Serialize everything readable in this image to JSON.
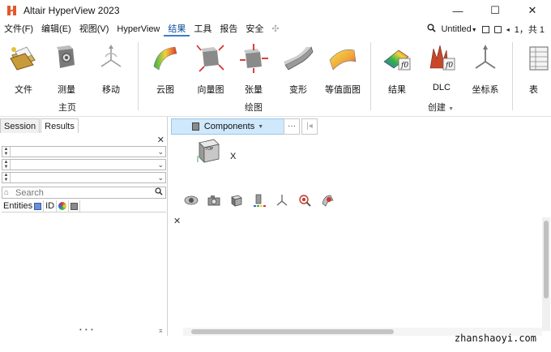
{
  "window": {
    "title": "Altair HyperView 2023",
    "minimize": "—",
    "maximize": "☐",
    "close": "✕"
  },
  "menu": {
    "items": [
      "文件(F)",
      "编辑(E)",
      "视图(V)",
      "HyperView",
      "结果",
      "工具",
      "报告",
      "安全",
      "✣"
    ],
    "active_index": 4,
    "right": {
      "search_icon": "search-icon",
      "doc_name": "Untitled",
      "page_text": "1，共 1"
    }
  },
  "ribbon": {
    "buttons": [
      {
        "label": "文件",
        "icon": "folder-icon"
      },
      {
        "label": "测量",
        "icon": "measure-icon"
      },
      {
        "label": "移动",
        "icon": "move-icon"
      },
      {
        "label": "云图",
        "icon": "contour-icon"
      },
      {
        "label": "向量图",
        "icon": "vector-icon"
      },
      {
        "label": "张量",
        "icon": "tensor-icon"
      },
      {
        "label": "变形",
        "icon": "deform-icon"
      },
      {
        "label": "等值面图",
        "icon": "isosurface-icon"
      },
      {
        "label": "结果",
        "icon": "results-icon"
      },
      {
        "label": "DLC",
        "icon": "dlc-icon"
      },
      {
        "label": "坐标系",
        "icon": "coordsys-icon"
      },
      {
        "label": "表",
        "icon": "table-icon"
      }
    ],
    "groups": [
      {
        "label": "主页"
      },
      {
        "label": "绘图"
      },
      {
        "label": "创建"
      }
    ],
    "group_more": "▼"
  },
  "left_panel": {
    "tabs": [
      "Session",
      "Results"
    ],
    "active_tab": 1,
    "close": "✕",
    "search_placeholder": "Search",
    "columns": [
      "Entities",
      "ID"
    ],
    "grip": "• • •",
    "pin": "⌅"
  },
  "canvas": {
    "entity_selector": "Components",
    "entity_more": "···",
    "entity_prev": "|◂",
    "triad_label": "X",
    "triad_top": "TOP",
    "close": "✕",
    "tool_icons": [
      "view-eye-icon",
      "camera-icon",
      "cube-icon",
      "legend-icon",
      "axis-icon",
      "zoom-fit-icon",
      "section-cut-icon"
    ]
  },
  "watermark": "zhanshaoyi.com",
  "colors": {
    "accent": "#3d7cc9",
    "entity_bar_bg": "#cfe8fb",
    "logo": "#e2582a"
  }
}
